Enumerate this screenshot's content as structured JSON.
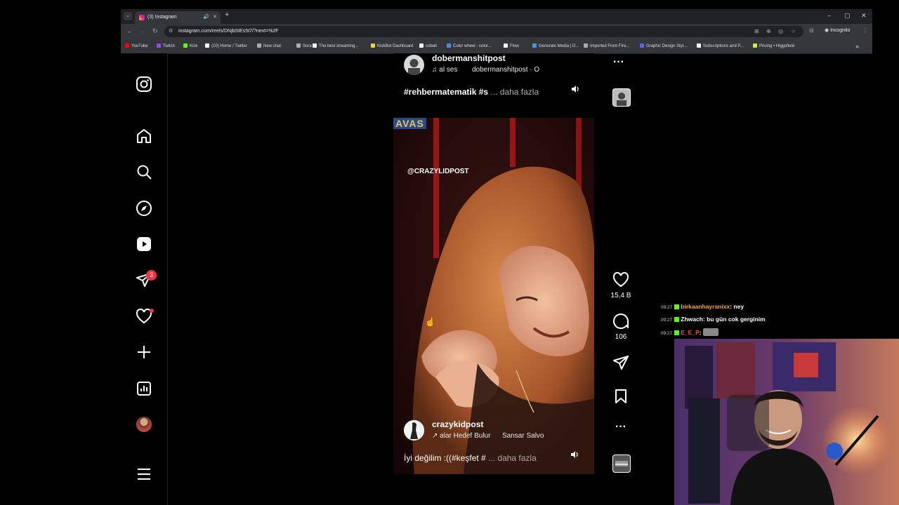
{
  "browser": {
    "tab_title": "(3) Instagram",
    "url": "instagram.com/reels/DNjbStEs5t7/?next=%2F",
    "incognito_label": "Incognito",
    "bookmarks": [
      {
        "label": "YouTube",
        "color": "#ff0000"
      },
      {
        "label": "Twitch",
        "color": "#9146ff"
      },
      {
        "label": "Kick",
        "color": "#53fc18"
      },
      {
        "label": "(10) Home / Twitter",
        "color": "#ffffff"
      },
      {
        "label": "New chat",
        "color": "#aaaaaa"
      },
      {
        "label": "Sora",
        "color": "#aaaaaa"
      },
      {
        "label": "The best streaming...",
        "color": "#ffffff"
      },
      {
        "label": "KickBot Dashboard",
        "color": "#f4d03f"
      },
      {
        "label": "cobalt",
        "color": "#ffffff"
      },
      {
        "label": "Color wheel - color...",
        "color": "#4a90e2"
      },
      {
        "label": "Flow",
        "color": "#ffffff"
      },
      {
        "label": "Generate Media | G...",
        "color": "#4a90e2"
      },
      {
        "label": "Imported From Fire...",
        "color": "#aaaaaa"
      },
      {
        "label": "Graphic Design Styl...",
        "color": "#4a6cf7"
      },
      {
        "label": "Subscriptions and P...",
        "color": "#ffffff"
      },
      {
        "label": "Pricing • Higgsfield",
        "color": "#c7f03b"
      }
    ]
  },
  "sidebar": {
    "items": [
      {
        "name": "instagram-logo-icon"
      },
      {
        "name": "home-icon"
      },
      {
        "name": "search-icon"
      },
      {
        "name": "explore-icon"
      },
      {
        "name": "reels-icon"
      },
      {
        "name": "messages-icon"
      },
      {
        "name": "notifications-icon"
      },
      {
        "name": "create-icon"
      },
      {
        "name": "dashboard-icon"
      },
      {
        "name": "profile-avatar"
      },
      {
        "name": "more-menu-icon"
      }
    ],
    "messages_badge": "3"
  },
  "reels": {
    "top": {
      "username": "dobermanshitpost",
      "audio": "al ses",
      "audio_user": "dobermanshitpost · O",
      "caption_tag": "#rehbermatematik #s",
      "caption_more": "... daha fazla"
    },
    "current": {
      "watermark": "@CRAZYLIDPOST",
      "logo_text": "AVAS",
      "username": "crazykidpost",
      "audio": "alar Hedef Bulur",
      "audio_user": "Sansar Salvo",
      "caption": "İyi değilim :((#keşfet #",
      "caption_more": "... daha fazla"
    },
    "actions": {
      "likes": "15,4 B",
      "comments": "106"
    }
  },
  "stream_chat": [
    {
      "time": "09:27",
      "user": "birkaanhayranixx",
      "user_color": "#f4a742",
      "message": "ney"
    },
    {
      "time": "09:27",
      "user": "Zhwach",
      "user_color": "#ffffff",
      "message": "bu gün cok gerginim"
    },
    {
      "time": "09:27",
      "user": "E_E_P",
      "user_color": "#ff4444",
      "message": ""
    }
  ]
}
